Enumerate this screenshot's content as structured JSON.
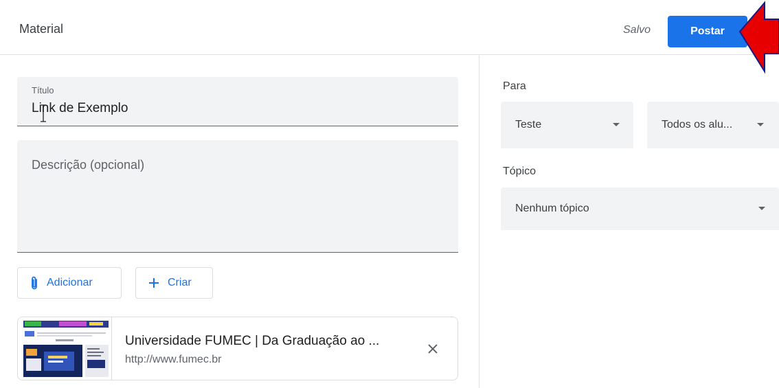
{
  "header": {
    "title": "Material",
    "saved_status": "Salvo",
    "post_button": "Postar"
  },
  "form": {
    "title_label": "Título",
    "title_value": "Link de Exemplo",
    "description_placeholder": "Descrição (opcional)",
    "add_button": "Adicionar",
    "create_button": "Criar"
  },
  "attachment": {
    "title": "Universidade FUMEC | Da Graduação ao ...",
    "url": "http://www.fumec.br"
  },
  "sidebar": {
    "for_label": "Para",
    "class_select": "Teste",
    "students_select": "Todos os alu...",
    "topic_label": "Tópico",
    "topic_select": "Nenhum tópico"
  },
  "colors": {
    "accent": "#1a73e8",
    "field_bg": "#f1f3f4",
    "annotation_arrow": "#e60000"
  },
  "icons": {
    "attach": "paperclip-icon",
    "create": "plus-icon",
    "remove": "close-icon",
    "dropdown": "caret-down-icon"
  }
}
